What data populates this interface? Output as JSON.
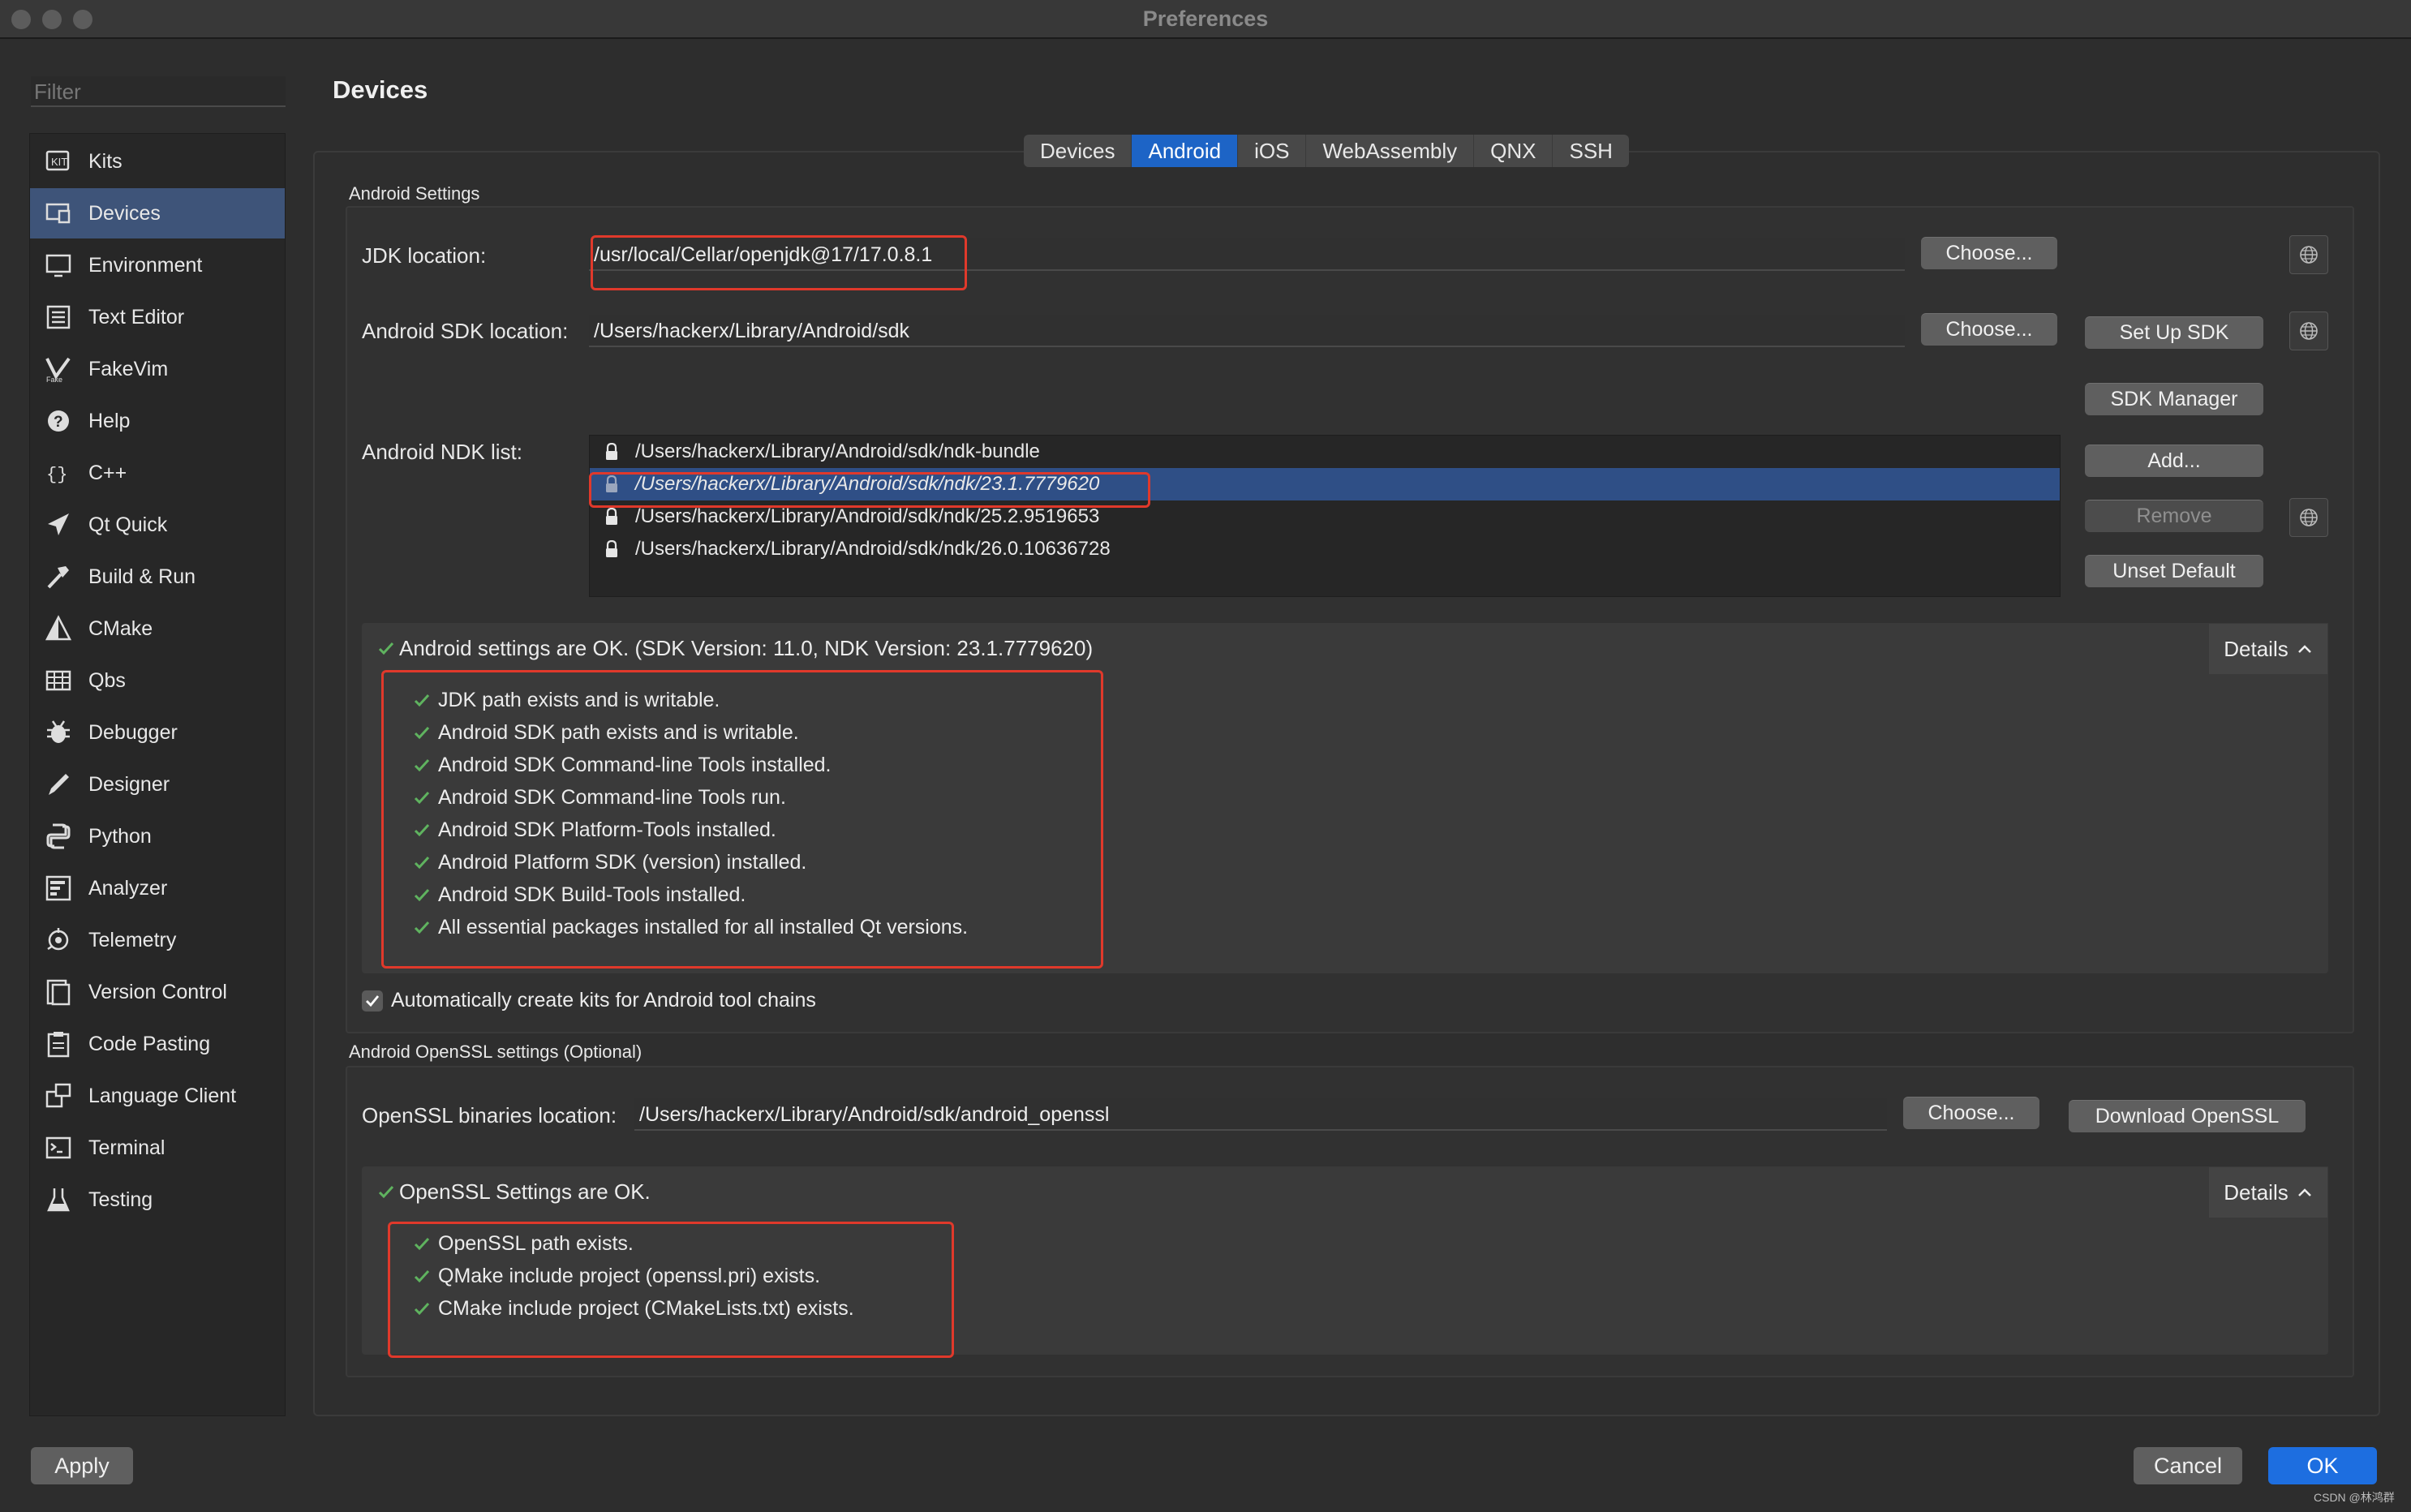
{
  "window": {
    "title": "Preferences"
  },
  "filter": {
    "placeholder": "Filter"
  },
  "sidebar": {
    "items": [
      {
        "label": "Kits",
        "icon": "kits-icon"
      },
      {
        "label": "Devices",
        "icon": "devices-icon",
        "selected": true
      },
      {
        "label": "Environment",
        "icon": "environment-icon"
      },
      {
        "label": "Text Editor",
        "icon": "text-editor-icon"
      },
      {
        "label": "FakeVim",
        "icon": "fakevim-icon"
      },
      {
        "label": "Help",
        "icon": "help-icon"
      },
      {
        "label": "C++",
        "icon": "cpp-icon"
      },
      {
        "label": "Qt Quick",
        "icon": "qt-quick-icon"
      },
      {
        "label": "Build & Run",
        "icon": "build-run-icon"
      },
      {
        "label": "CMake",
        "icon": "cmake-icon"
      },
      {
        "label": "Qbs",
        "icon": "qbs-icon"
      },
      {
        "label": "Debugger",
        "icon": "debugger-icon"
      },
      {
        "label": "Designer",
        "icon": "designer-icon"
      },
      {
        "label": "Python",
        "icon": "python-icon"
      },
      {
        "label": "Analyzer",
        "icon": "analyzer-icon"
      },
      {
        "label": "Telemetry",
        "icon": "telemetry-icon"
      },
      {
        "label": "Version Control",
        "icon": "version-control-icon"
      },
      {
        "label": "Code Pasting",
        "icon": "code-pasting-icon"
      },
      {
        "label": "Language Client",
        "icon": "language-client-icon"
      },
      {
        "label": "Terminal",
        "icon": "terminal-icon"
      },
      {
        "label": "Testing",
        "icon": "testing-icon"
      }
    ]
  },
  "page": {
    "title": "Devices"
  },
  "tabs": [
    "Devices",
    "Android",
    "iOS",
    "WebAssembly",
    "QNX",
    "SSH"
  ],
  "active_tab": "Android",
  "android": {
    "group_label": "Android Settings",
    "jdk_label": "JDK location:",
    "jdk_value": "/usr/local/Cellar/openjdk@17/17.0.8.1",
    "sdk_label": "Android SDK location:",
    "sdk_value": "/Users/hackerx/Library/Android/sdk",
    "ndk_label": "Android NDK list:",
    "ndk_list": [
      "/Users/hackerx/Library/Android/sdk/ndk-bundle",
      "/Users/hackerx/Library/Android/sdk/ndk/23.1.7779620",
      "/Users/hackerx/Library/Android/sdk/ndk/25.2.9519653",
      "/Users/hackerx/Library/Android/sdk/ndk/26.0.10636728"
    ],
    "ndk_selected_index": 1,
    "choose_label": "Choose...",
    "setup_sdk_label": "Set Up SDK",
    "sdk_manager_label": "SDK Manager",
    "add_label": "Add...",
    "remove_label": "Remove",
    "unset_default_label": "Unset Default",
    "status": "Android settings are OK. (SDK Version: 11.0, NDK Version: 23.1.7779620)",
    "details_label": "Details",
    "checks": [
      "JDK path exists and is writable.",
      "Android SDK path exists and is writable.",
      "Android SDK Command-line Tools installed.",
      "Android SDK Command-line Tools run.",
      "Android SDK Platform-Tools installed.",
      "Android Platform SDK (version) installed.",
      "Android SDK Build-Tools installed.",
      "All essential packages installed for all installed Qt versions."
    ],
    "auto_kits_label": "Automatically create kits for Android tool chains",
    "auto_kits_checked": true
  },
  "openssl": {
    "group_label": "Android OpenSSL settings (Optional)",
    "location_label": "OpenSSL binaries location:",
    "location_value": "/Users/hackerx/Library/Android/sdk/android_openssl",
    "choose_label": "Choose...",
    "download_label": "Download OpenSSL",
    "status": "OpenSSL Settings are OK.",
    "details_label": "Details",
    "checks": [
      "OpenSSL path exists.",
      "QMake include project (openssl.pri) exists.",
      "CMake include project (CMakeLists.txt) exists."
    ]
  },
  "footer": {
    "apply_label": "Apply",
    "cancel_label": "Cancel",
    "ok_label": "OK",
    "watermark": "CSDN @林鸿群"
  },
  "colors": {
    "accent": "#1d64c6",
    "selection": "#2f4f86",
    "highlight": "#e0392b",
    "check": "#5fb35f"
  }
}
